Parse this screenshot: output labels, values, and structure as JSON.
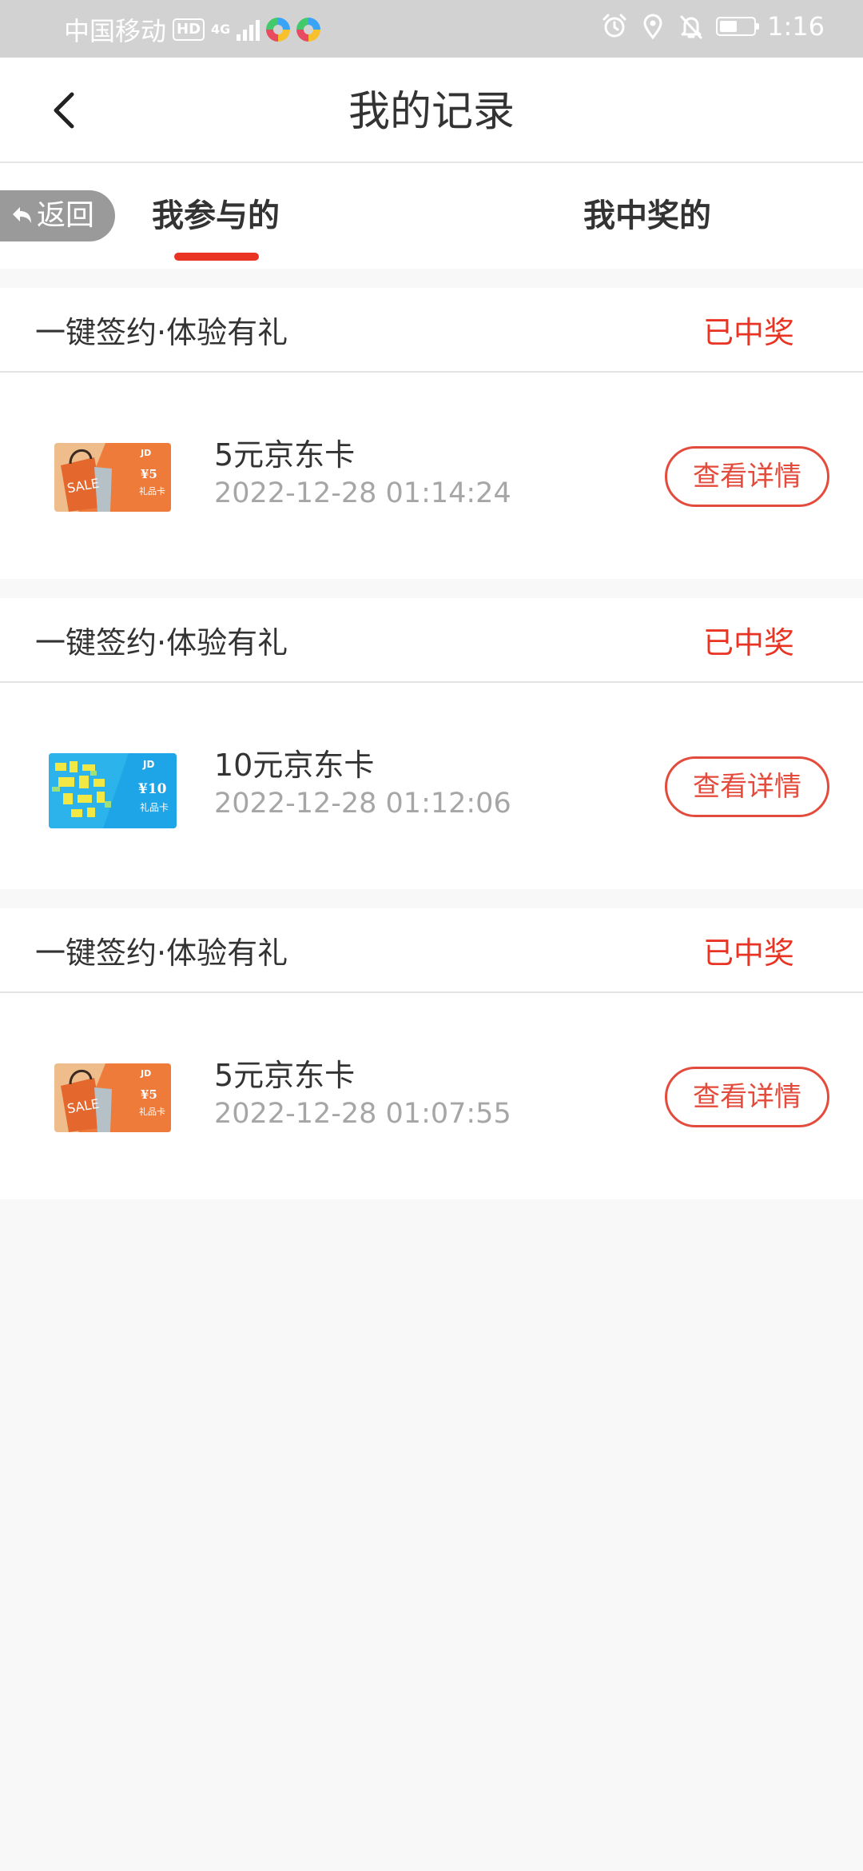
{
  "status_bar": {
    "carrier": "中国移动",
    "hd": "HD",
    "network": "4G",
    "time": "1:16",
    "icons": [
      "alarm-icon",
      "location-icon",
      "bell-off-icon",
      "battery-icon"
    ]
  },
  "header": {
    "title": "我的记录",
    "back_icon": "chevron-left-icon"
  },
  "tabs": {
    "back_label": "返回",
    "items": [
      {
        "label": "我参与的",
        "active": true
      },
      {
        "label": "我中奖的",
        "active": false
      }
    ]
  },
  "records": [
    {
      "activity": "一键签约·体验有礼",
      "status": "已中奖",
      "prize": "5元京东卡",
      "time": "2022-12-28 01:14:24",
      "button": "查看详情",
      "card": {
        "style": "orange",
        "brand": "JD",
        "amount": "¥5",
        "label": "礼品卡",
        "sale": "SALE"
      }
    },
    {
      "activity": "一键签约·体验有礼",
      "status": "已中奖",
      "prize": "10元京东卡",
      "time": "2022-12-28 01:12:06",
      "button": "查看详情",
      "card": {
        "style": "blue",
        "brand": "JD",
        "amount": "¥10",
        "label": "礼品卡"
      }
    },
    {
      "activity": "一键签约·体验有礼",
      "status": "已中奖",
      "prize": "5元京东卡",
      "time": "2022-12-28 01:07:55",
      "button": "查看详情",
      "card": {
        "style": "orange",
        "brand": "JD",
        "amount": "¥5",
        "label": "礼品卡",
        "sale": "SALE"
      }
    }
  ],
  "colors": {
    "accent": "#e93323",
    "button_border": "#e34b3c",
    "status_bar": "#d2d2d2",
    "page_bg": "#f8f8f8"
  }
}
